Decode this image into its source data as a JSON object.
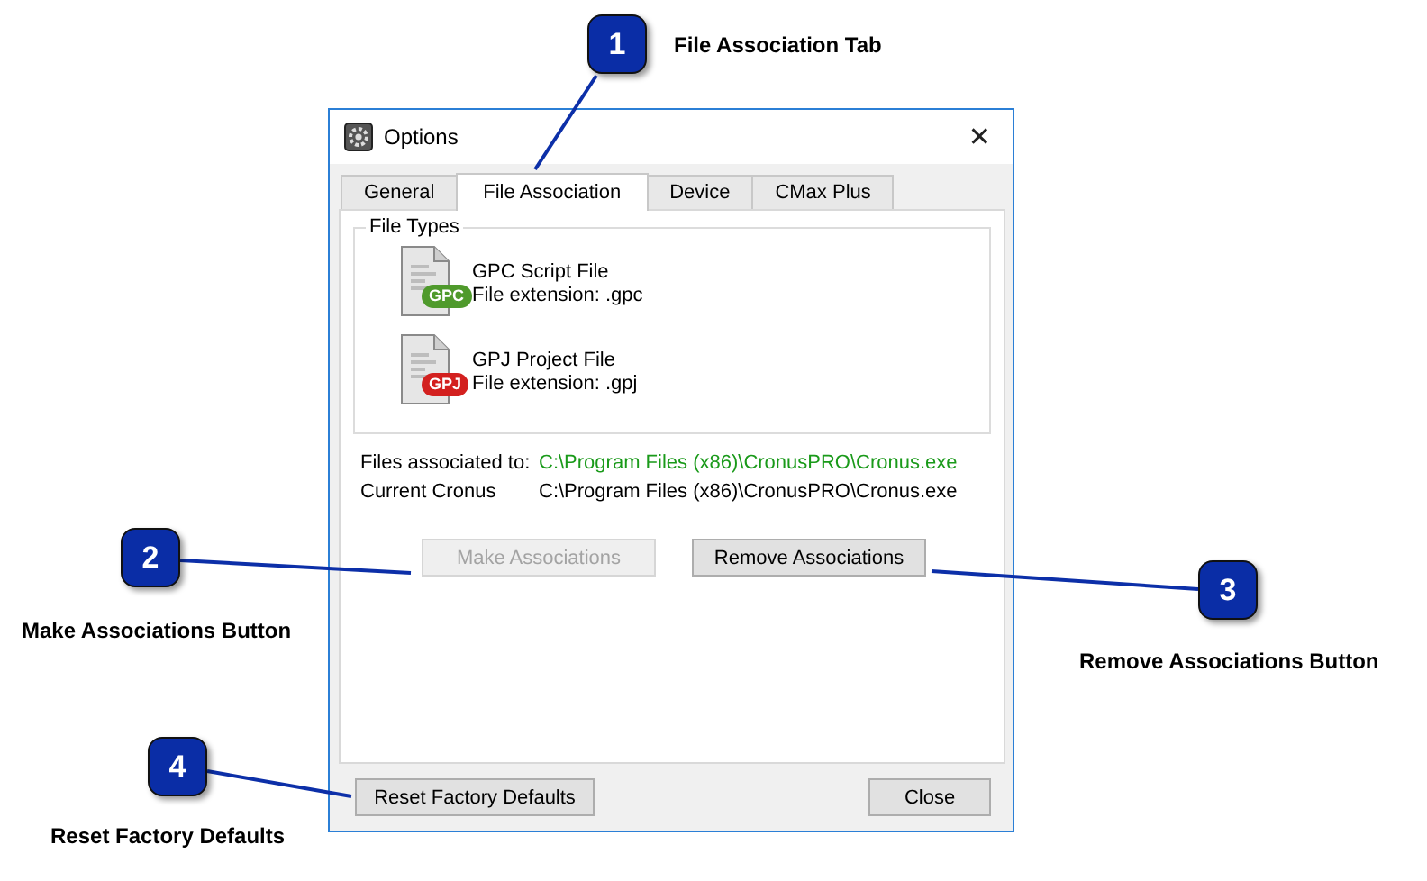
{
  "callouts": [
    {
      "number": "1",
      "label": "File Association Tab"
    },
    {
      "number": "2",
      "label": "Make Associations Button"
    },
    {
      "number": "3",
      "label": "Remove Associations Button"
    },
    {
      "number": "4",
      "label": "Reset Factory Defaults"
    }
  ],
  "window": {
    "title": "Options",
    "close": "✕"
  },
  "tabs": [
    {
      "label": "General",
      "selected": false
    },
    {
      "label": "File Association",
      "selected": true
    },
    {
      "label": "Device",
      "selected": false
    },
    {
      "label": "CMax Plus",
      "selected": false
    }
  ],
  "file_types": {
    "legend": "File Types",
    "items": [
      {
        "name": "GPC Script File",
        "extension": "File extension: .gpc",
        "badge": "GPC",
        "color": "#4f9a2c"
      },
      {
        "name": "GPJ Project File",
        "extension": "File extension: .gpj",
        "badge": "GPJ",
        "color": "#d3201f"
      }
    ]
  },
  "info": [
    {
      "label": "Files associated to:",
      "value": "C:\\Program Files (x86)\\CronusPRO\\Cronus.exe",
      "highlighted": true
    },
    {
      "label": "Current Cronus",
      "value": "C:\\Program Files (x86)\\CronusPRO\\Cronus.exe",
      "highlighted": false
    }
  ],
  "actions": [
    {
      "label": "Make Associations",
      "disabled": true
    },
    {
      "label": "Remove Associations",
      "disabled": false
    }
  ],
  "footer": {
    "reset": "Reset Factory Defaults",
    "close": "Close"
  }
}
